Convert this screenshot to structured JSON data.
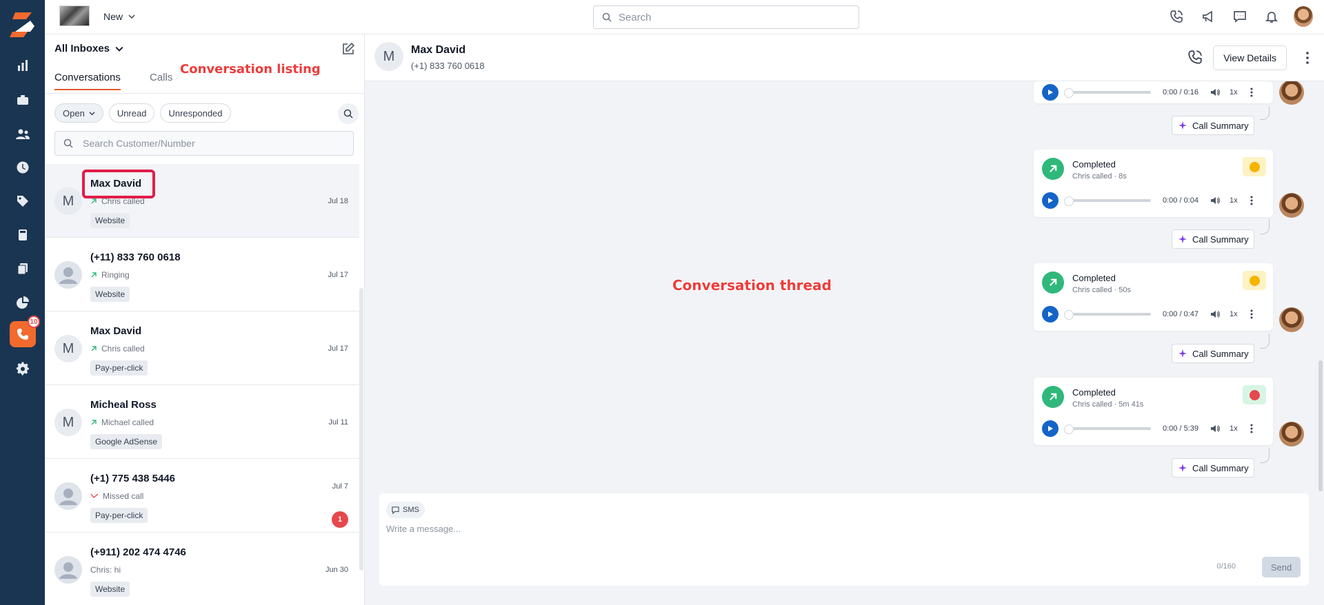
{
  "topbar": {
    "new_label": "New",
    "search_placeholder": "Search"
  },
  "rail": {
    "calls_badge": "10"
  },
  "list": {
    "inbox_label": "All Inboxes",
    "annotation": "Conversation listing",
    "tabs": [
      "Conversations",
      "Calls"
    ],
    "filters": [
      "Open",
      "Unread",
      "Unresponded"
    ],
    "search_placeholder": "Search Customer/Number",
    "conversations": [
      {
        "initial": "M",
        "name": "Max David",
        "sub": "Chris called",
        "tag": "Website",
        "date": "Jul 18"
      },
      {
        "initial": "",
        "name": "(+11) 833 760 0618",
        "sub": "Ringing",
        "tag": "Website",
        "date": "Jul 17"
      },
      {
        "initial": "M",
        "name": "Max David",
        "sub": "Chris called",
        "tag": "Pay-per-click",
        "date": "Jul 17"
      },
      {
        "initial": "M",
        "name": "Micheal Ross",
        "sub": "Michael called",
        "tag": "Google AdSense",
        "date": "Jul 11"
      },
      {
        "initial": "",
        "name": "(+1) 775 438 5446",
        "sub": "Missed call",
        "tag": "Pay-per-click",
        "date": "Jul 7",
        "unread": "1"
      },
      {
        "initial": "",
        "name": "(+911) 202 474 4746",
        "sub": "Chris: hi",
        "tag": "Website",
        "date": "Jun 30"
      }
    ]
  },
  "thread": {
    "initial": "M",
    "name": "Max David",
    "phone": "(+1) 833 760 0618",
    "view_details": "View Details",
    "annotation": "Conversation thread",
    "calls": [
      {
        "status": "",
        "sub": "",
        "time": "0:00 / 0:16",
        "speed": "1x"
      },
      {
        "status": "Completed",
        "sub": "Chris called · 8s",
        "time": "0:00 / 0:04",
        "speed": "1x",
        "sentiment": "neutral"
      },
      {
        "status": "Completed",
        "sub": "Chris called · 50s",
        "time": "0:00 / 0:47",
        "speed": "1x",
        "sentiment": "neutral"
      },
      {
        "status": "Completed",
        "sub": "Chris called · 5m 41s",
        "time": "0:00 / 5:39",
        "speed": "1x",
        "sentiment": "positive"
      }
    ],
    "summary_label": "Call Summary"
  },
  "composer": {
    "channel": "SMS",
    "placeholder": "Write a message...",
    "counter": "0/160",
    "send_label": "Send"
  },
  "colors": {
    "rail_bg": "#1a3551",
    "accent": "#f26a2e",
    "call_green": "#2fb87a",
    "play_blue": "#1464c8",
    "annotation_red": "#ef3b3b"
  }
}
